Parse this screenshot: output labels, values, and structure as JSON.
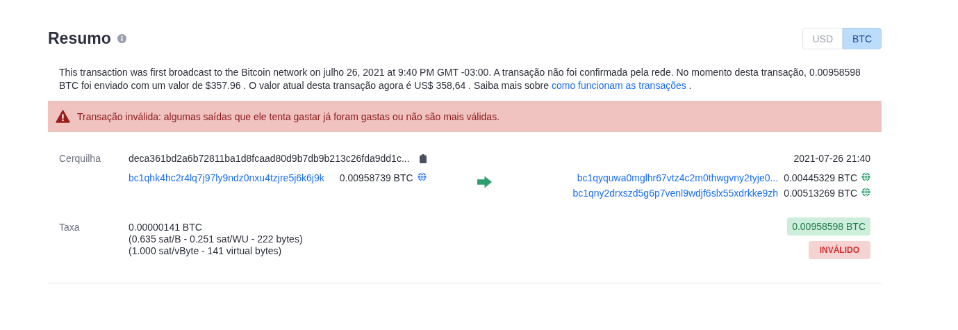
{
  "header": {
    "title": "Resumo",
    "currency_toggle": [
      {
        "label": "USD",
        "selected": false
      },
      {
        "label": "BTC",
        "selected": true
      }
    ]
  },
  "summary": {
    "text_before": "This transaction was first broadcast to the Bitcoin network on julho 26, 2021 at 9:40 PM GMT -03:00.  A transação não foi confirmada pela rede.  No momento desta transação, 0.00958598 BTC foi enviado com um valor de $357.96 . O valor atual desta transação agora é US$ 358,64 .  Saiba mais sobre ",
    "link": "como funcionam as transações",
    "text_after": " ."
  },
  "alert": {
    "message": "Transação inválida: algumas saídas que ele tenta gastar já foram gastas ou não são mais válidas."
  },
  "transaction": {
    "hash_label": "Cerquilha",
    "hash": "deca361bd2a6b72811ba1d8fcaad80d9b7db9b213c26fda9dd1c...",
    "time": "2021-07-26 21:40",
    "inputs": [
      {
        "address": "bc1qhk4hc2r4lq7j97ly9ndz0nxu4tzjre5j6k6j9k",
        "amount": "0.00958739 BTC",
        "spent": false
      }
    ],
    "outputs": [
      {
        "address": "bc1qyquwa0mglhr67vtz4c2m0thwgvny2tyje0...",
        "amount": "0.00445329 BTC",
        "spent": true
      },
      {
        "address": "bc1qny2drxszd5g6p7venl9wdjf6slx55xdrkke9zh",
        "amount": "0.00513269 BTC",
        "spent": true
      }
    ],
    "fee_label": "Taxa",
    "fee": [
      "0.00000141 BTC",
      "(0.635 sat/B - 0.251 sat/WU - 222 bytes)",
      "(1.000 sat/vByte - 141 virtual bytes)"
    ],
    "total": "0.00958598 BTC",
    "status": "INVÁLIDO"
  }
}
